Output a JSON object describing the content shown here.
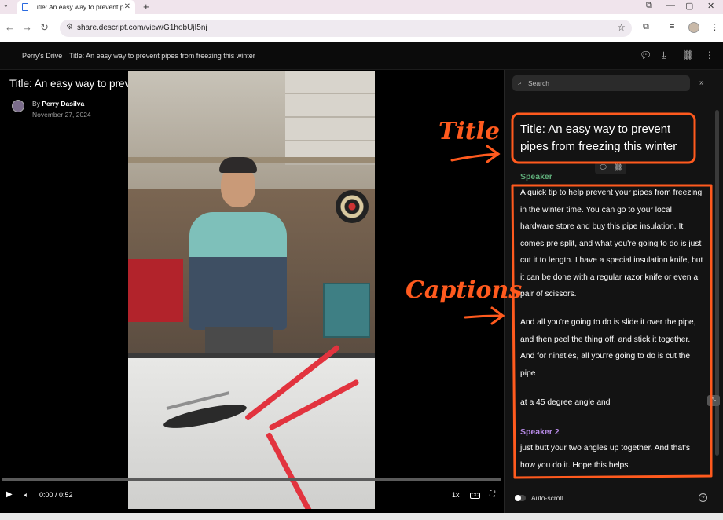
{
  "browser": {
    "tab_title": "Title: An easy way to prevent p",
    "url": "share.descript.com/view/G1hobUjI5nj"
  },
  "header": {
    "drive": "Perry's Drive",
    "title": "Title: An easy way to prevent pipes from freezing this winter"
  },
  "video": {
    "title": "Title: An easy way to prevent pipes from freezing this winter",
    "by_prefix": "By",
    "author": "Perry Dasilva",
    "date": "November 27, 2024",
    "time": "0:00 / 0:52",
    "speed": "1x",
    "progress": 0.0
  },
  "transcript": {
    "search_placeholder": "Search",
    "title": "Title: An easy way to prevent pipes from freezing this winter",
    "speaker1": "Speaker",
    "speaker2": "Speaker 2",
    "paragraphs": [
      "A quick tip to help prevent your pipes from freezing in the winter time. You can go to your local hardware store and buy this pipe insulation. It comes pre split, and what you're going to do is just cut it to length. I have a special insulation knife, but it can be done with a regular razor knife or even a pair of scissors.",
      "And all you're going to do is slide it over the pipe, and then peel the thing off. and stick it together. And for nineties, all you're going to do is cut the pipe",
      "at a 45 degree angle and",
      "just butt your two angles up together. And that's how you do it. Hope this helps."
    ],
    "autoscroll_label": "Auto-scroll"
  },
  "annotations": {
    "title_note": "Title",
    "captions_note": "Captions"
  },
  "colors": {
    "annotation": "#ff5a1e",
    "speaker1": "#5fae7a",
    "speaker2": "#b68ae6"
  }
}
